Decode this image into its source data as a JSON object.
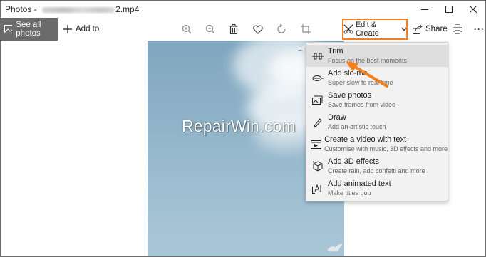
{
  "window": {
    "title_app": "Photos - ",
    "title_ext": "2.mp4",
    "controls": {
      "minimize": "—",
      "maximize": "☐",
      "close": "✕"
    }
  },
  "toolbar": {
    "see_all_label": "See all photos",
    "add_to_label": "Add to",
    "edit_create_label": "Edit & Create",
    "share_label": "Share",
    "more_label": "···",
    "icons": [
      "zoom-in-icon",
      "zoom-out-icon",
      "trash-icon",
      "heart-icon",
      "rotate-icon",
      "crop-icon",
      "print-icon"
    ]
  },
  "watermark": "RepairWin.com",
  "menu": {
    "items": [
      {
        "title": "Trim",
        "subtitle": "Focus on the best moments",
        "icon": "trim-icon"
      },
      {
        "title": "Add slo-mo",
        "subtitle": "Super slow to real time",
        "icon": "slo-mo-icon"
      },
      {
        "title": "Save photos",
        "subtitle": "Save frames from video",
        "icon": "save-photos-icon"
      },
      {
        "title": "Draw",
        "subtitle": "Add an artistic touch",
        "icon": "draw-icon"
      },
      {
        "title": "Create a video with text",
        "subtitle": "Customise with music, 3D effects and more",
        "icon": "video-text-icon"
      },
      {
        "title": "Add 3D effects",
        "subtitle": "Create rain, add confetti and more",
        "icon": "3d-effects-icon"
      },
      {
        "title": "Add animated text",
        "subtitle": "Make titles pop",
        "icon": "animated-text-icon"
      }
    ]
  },
  "colors": {
    "highlight": "#f08020",
    "see_all_bg": "#6b6b6b",
    "menu_bg": "#f2f2f2",
    "menu_hover": "#dedede"
  }
}
